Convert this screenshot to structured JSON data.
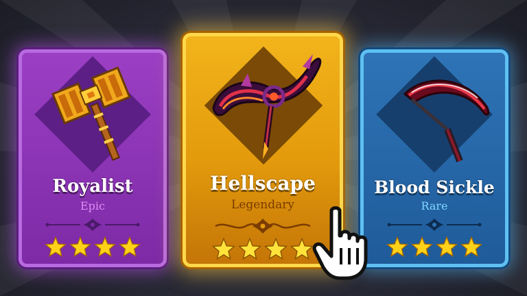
{
  "cards": [
    {
      "name": "Royalist",
      "rarity": "Epic",
      "stars": 4,
      "item_icon": "golden-hammer-icon"
    },
    {
      "name": "Hellscape",
      "rarity": "Legendary",
      "stars": 4,
      "item_icon": "demon-scythe-icon"
    },
    {
      "name": "Blood Sickle",
      "rarity": "Rare",
      "stars": 4,
      "item_icon": "blood-sickle-icon"
    }
  ],
  "selected_card": "Hellscape",
  "colors": {
    "epic": "#9b3fc4",
    "legendary": "#f2b41b",
    "rare": "#2e74b6",
    "star": "#ffd21a"
  }
}
